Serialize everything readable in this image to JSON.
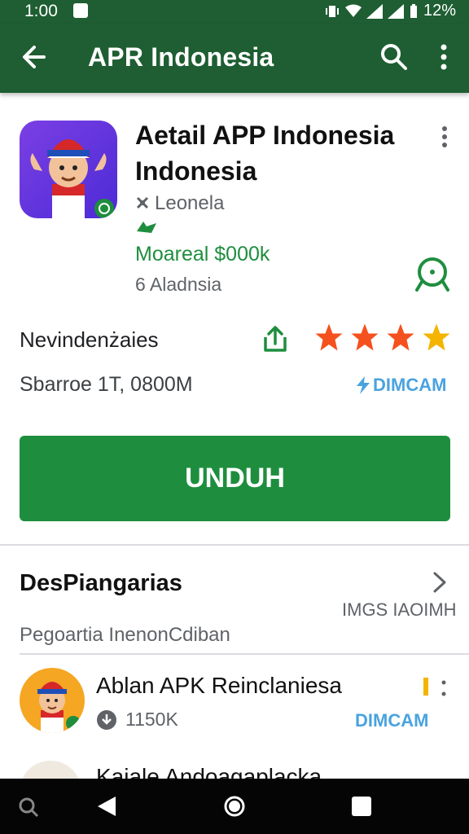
{
  "status_bar": {
    "time": "1:00",
    "battery": "12%"
  },
  "app_bar": {
    "title": "APR Indonesia",
    "icons": [
      "back-arrow-icon",
      "search-icon",
      "more-vert-icon"
    ]
  },
  "app": {
    "title": "Aetail APP Indonesia Indonesia",
    "developer": "Leonela",
    "price": "Moareal $000k",
    "region": "6 Aladnsia",
    "rating_label": "Nevindenżaies",
    "stars": 4,
    "size_label": "Sbarroe 1T, 0800M",
    "domain_label": "DIMCAM",
    "install_label": "UNDUH"
  },
  "section": {
    "title": "DesPiangarias",
    "meta": "IMGS IAOIMH",
    "subtitle": "Pegoartia InenonCdiban"
  },
  "list": [
    {
      "title": "Ablan APK Reinclaniesa",
      "meta": "1150K",
      "domain": "DIMCAM"
    },
    {
      "title": "Kaiale Andoagaplacka"
    }
  ],
  "colors": {
    "app_bar_bg": "#1e5e32",
    "primary_green": "#1e8e3e",
    "star_orange": "#f4511e",
    "star_yellow": "#f4b400",
    "link_blue": "#4aa3df"
  }
}
